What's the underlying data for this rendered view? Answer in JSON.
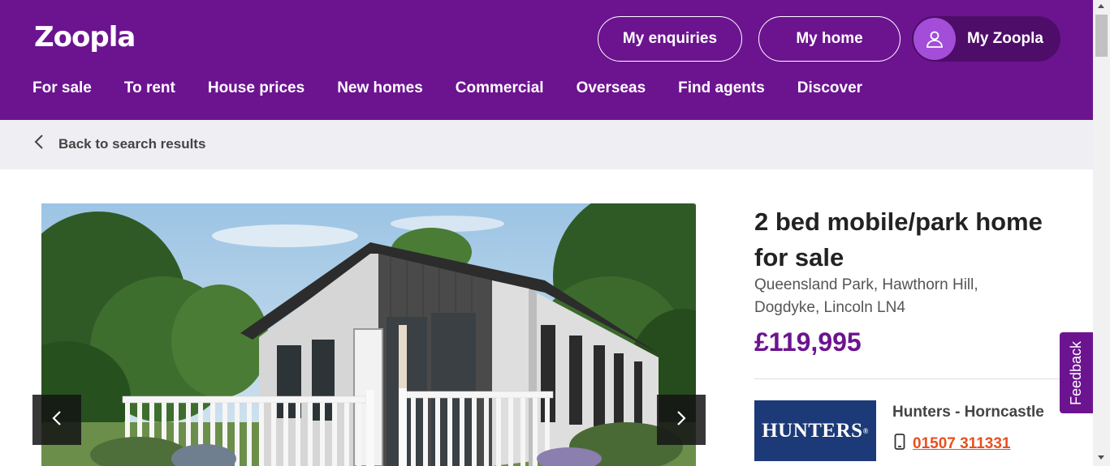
{
  "brand": {
    "logo_text": "Zoopla",
    "primary_color": "#6c1490",
    "accent_color": "#e8501e"
  },
  "header": {
    "my_enquiries": "My enquiries",
    "my_home": "My home",
    "my_zoopla": "My Zoopla",
    "nav": [
      "For sale",
      "To rent",
      "House prices",
      "New homes",
      "Commercial",
      "Overseas",
      "Find agents",
      "Discover"
    ]
  },
  "subnav": {
    "back_label": "Back to search results"
  },
  "listing": {
    "title": "2 bed mobile/park home for sale",
    "address": "Queensland Park, Hawthorn Hill, Dogdyke, Lincoln LN4",
    "price": "£119,995"
  },
  "agent": {
    "logo_text": "HUNTERS",
    "logo_mark": "®",
    "name": "Hunters - Horncastle",
    "phone": "01507 311331"
  },
  "feedback": {
    "label": "Feedback"
  },
  "icons": {
    "back": "chevron-left-icon",
    "prev": "chevron-left-icon",
    "next": "chevron-right-icon",
    "user": "user-icon",
    "phone": "mobile-phone-icon"
  }
}
